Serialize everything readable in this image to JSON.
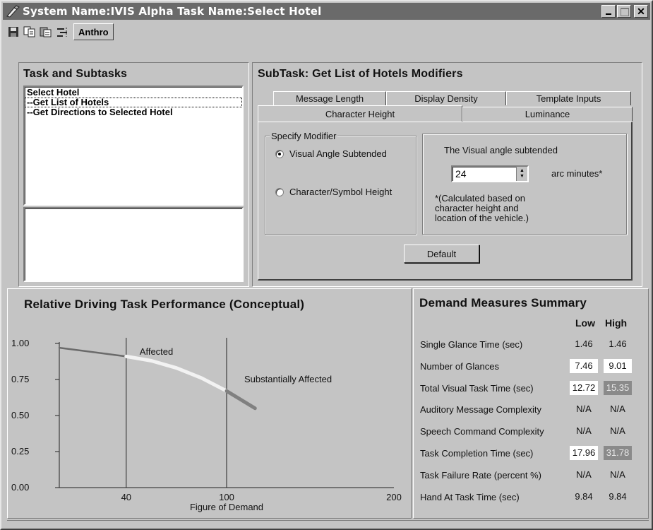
{
  "window": {
    "title": "System Name:IVIS Alpha Task Name:Select Hotel"
  },
  "toolbar": {
    "anthro_label": "Anthro"
  },
  "tasks": {
    "title": "Task and Subtasks",
    "items": [
      "Select Hotel",
      "--Get List of Hotels",
      "--Get Directions to Selected Hotel"
    ]
  },
  "subtask": {
    "title": "SubTask: Get List of Hotels Modifiers",
    "tabs_back": [
      "Message Length",
      "Display Density",
      "Template Inputs"
    ],
    "tabs_front": [
      "Character Height",
      "Luminance"
    ],
    "specify_label": "Specify Modifier",
    "option_visual": "Visual Angle Subtended",
    "option_char": "Character/Symbol Height",
    "visual_angle_label": "The Visual angle subtended",
    "value": "24",
    "unit": "arc minutes*",
    "note_line1": "*(Calculated based on",
    "note_line2": "character height and",
    "note_line3": "location of the vehicle.)",
    "default_button": "Default"
  },
  "chart": {
    "title": "Relative Driving Task Performance (Conceptual)",
    "y_ticks": [
      "1.00",
      "0.75",
      "0.50",
      "0.25",
      "0.00"
    ],
    "x_ticks": [
      "40",
      "100",
      "200"
    ],
    "xlabel": "Figure of Demand",
    "region1": "Affected",
    "region2": "Substantially Affected"
  },
  "chart_data": {
    "type": "line",
    "xlabel": "Figure of Demand",
    "ylabel": "",
    "xlim": [
      0,
      200
    ],
    "ylim": [
      0,
      1
    ],
    "x_ticks": [
      40,
      100,
      200
    ],
    "y_ticks": [
      0,
      0.25,
      0.5,
      0.75,
      1.0
    ],
    "vertical_lines": [
      40,
      100
    ],
    "annotations": [
      "Affected",
      "Substantially Affected"
    ],
    "series": [
      {
        "x": [
          0,
          40
        ],
        "y": [
          0.97,
          0.91
        ],
        "color": "#6a6a6a"
      },
      {
        "x": [
          40,
          55,
          70,
          85,
          100
        ],
        "y": [
          0.91,
          0.88,
          0.83,
          0.76,
          0.67
        ],
        "color": "#f2f2f2"
      },
      {
        "x": [
          100,
          117
        ],
        "y": [
          0.67,
          0.55
        ],
        "color": "#808080"
      }
    ]
  },
  "summary": {
    "title": "Demand Measures Summary",
    "col_low": "Low",
    "col_high": "High",
    "rows": [
      {
        "label": "Single Glance Time (sec)",
        "low": "1.46",
        "high": "1.46"
      },
      {
        "label": "Number of Glances",
        "low": "7.46",
        "high": "9.01"
      },
      {
        "label": "Total Visual Task Time (sec)",
        "low": "12.72",
        "high": "15.35"
      },
      {
        "label": "Auditory Message Complexity",
        "low": "N/A",
        "high": "N/A"
      },
      {
        "label": "Speech Command Complexity",
        "low": "N/A",
        "high": "N/A"
      },
      {
        "label": "Task Completion Time (sec)",
        "low": "17.96",
        "high": "31.78"
      },
      {
        "label": "Task Failure Rate (percent %)",
        "low": "N/A",
        "high": "N/A"
      },
      {
        "label": "Hand At Task Time (sec)",
        "low": "9.84",
        "high": "9.84"
      }
    ]
  }
}
